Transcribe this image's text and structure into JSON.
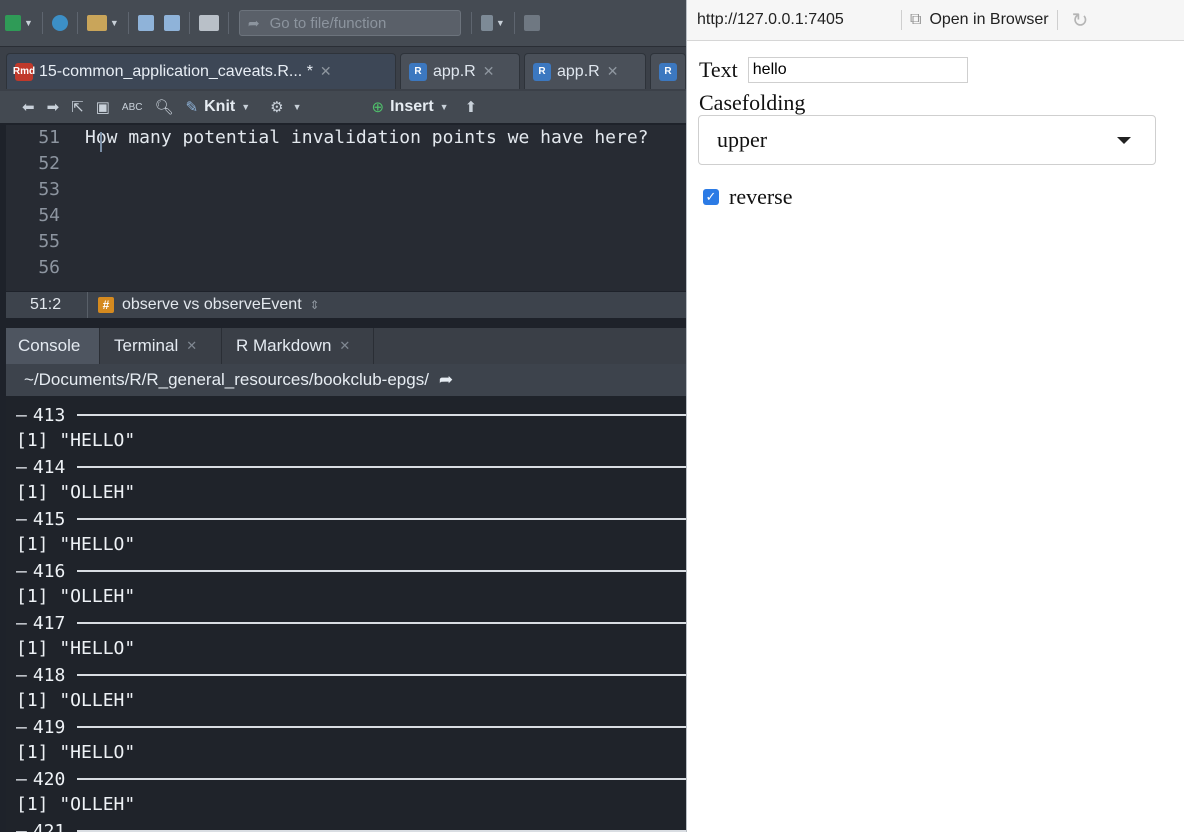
{
  "toolbar": {
    "goto_placeholder": "Go to file/function"
  },
  "editor_tabs": [
    {
      "label": "15-common_application_caveats.R... *",
      "icon": "rmd-file-icon",
      "active": true
    },
    {
      "label": "app.R",
      "icon": "r-file-icon",
      "active": false
    },
    {
      "label": "app.R",
      "icon": "r-file-icon",
      "active": false
    }
  ],
  "editor_toolbar": {
    "knit_label": "Knit",
    "insert_label": "Insert"
  },
  "editor": {
    "lines": [
      {
        "num": "51",
        "text": "How many potential invalidation points we have here?"
      },
      {
        "num": "52",
        "text": ""
      },
      {
        "num": "53",
        "text": ""
      },
      {
        "num": "54",
        "text": ""
      },
      {
        "num": "55",
        "text": ""
      },
      {
        "num": "56",
        "text": ""
      }
    ]
  },
  "status": {
    "position": "51:2",
    "section": "observe vs observeEvent"
  },
  "console_tabs": [
    {
      "label": "Console",
      "active": true
    },
    {
      "label": "Terminal",
      "active": false
    },
    {
      "label": "R Markdown",
      "active": false
    }
  ],
  "console": {
    "path": "~/Documents/R/R_general_resources/bookclub-epgs/",
    "entries": [
      {
        "sep": "413",
        "out": "[1] \"HELLO\""
      },
      {
        "sep": "414",
        "out": "[1] \"OLLEH\""
      },
      {
        "sep": "415",
        "out": "[1] \"HELLO\""
      },
      {
        "sep": "416",
        "out": "[1] \"OLLEH\""
      },
      {
        "sep": "417",
        "out": "[1] \"HELLO\""
      },
      {
        "sep": "418",
        "out": "[1] \"OLLEH\""
      },
      {
        "sep": "419",
        "out": "[1] \"HELLO\""
      },
      {
        "sep": "420",
        "out": "[1] \"OLLEH\""
      },
      {
        "sep": "421",
        "out": ""
      }
    ]
  },
  "viewer": {
    "url": "http://127.0.0.1:7405",
    "open_label": "Open in Browser"
  },
  "app": {
    "text_label": "Text",
    "text_value": "hello",
    "case_label": "Casefolding",
    "case_value": "upper",
    "reverse_label": "reverse",
    "reverse_checked": true
  },
  "colors": {
    "accent": "#2c7be5",
    "section_badge": "#d58a1f"
  }
}
